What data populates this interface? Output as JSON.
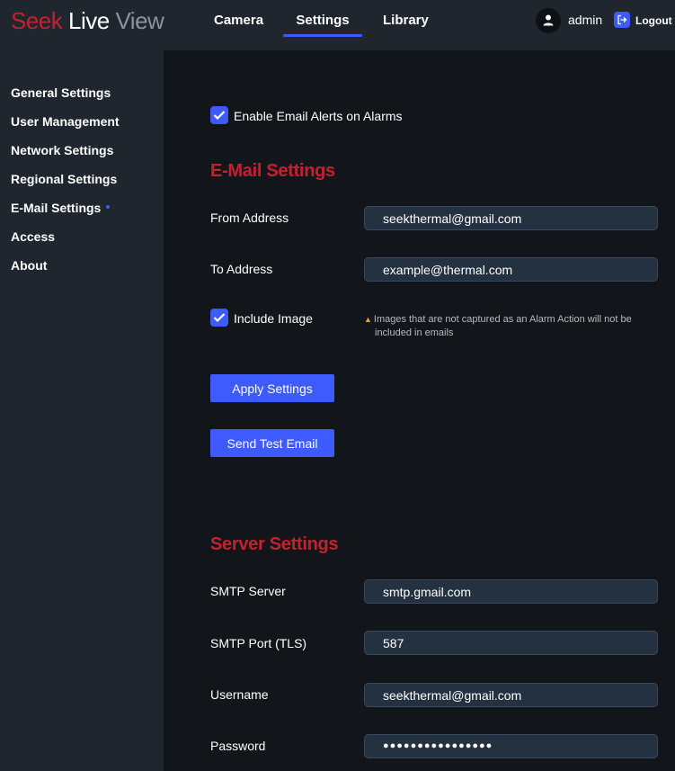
{
  "header": {
    "logo": {
      "part1": "Seek",
      "part2": "Live",
      "part3": "View"
    },
    "tabs": [
      {
        "label": "Camera"
      },
      {
        "label": "Settings"
      },
      {
        "label": "Library"
      }
    ],
    "user": {
      "name": "admin"
    },
    "logout_label": "Logout",
    "accent_color": "#3d5bff",
    "brand_color": "#c4212f"
  },
  "sidebar": {
    "items": [
      {
        "label": "General Settings"
      },
      {
        "label": "User Management"
      },
      {
        "label": "Network Settings"
      },
      {
        "label": "Regional Settings"
      },
      {
        "label": "E-Mail Settings"
      },
      {
        "label": "Access"
      },
      {
        "label": "About"
      }
    ]
  },
  "email_alerts": {
    "enable_label": "Enable Email Alerts on Alarms",
    "enabled": true
  },
  "email_settings": {
    "title": "E-Mail Settings",
    "from_label": "From Address",
    "from_value": "seekthermal@gmail.com",
    "to_label": "To Address",
    "to_value": "example@thermal.com",
    "include_image_label": "Include Image",
    "include_image": true,
    "warning_line1": "Images that are not captured as an Alarm Action will not be",
    "warning_line2": "included in emails",
    "apply_label": "Apply Settings",
    "test_label": "Send Test Email"
  },
  "server_settings": {
    "title": "Server Settings",
    "smtp_server_label": "SMTP Server",
    "smtp_server_value": "smtp.gmail.com",
    "smtp_port_label": "SMTP Port (TLS)",
    "smtp_port_value": "587",
    "username_label": "Username",
    "username_value": "seekthermal@gmail.com",
    "password_label": "Password",
    "password_value": "●●●●●●●●●●●●●●●●"
  }
}
